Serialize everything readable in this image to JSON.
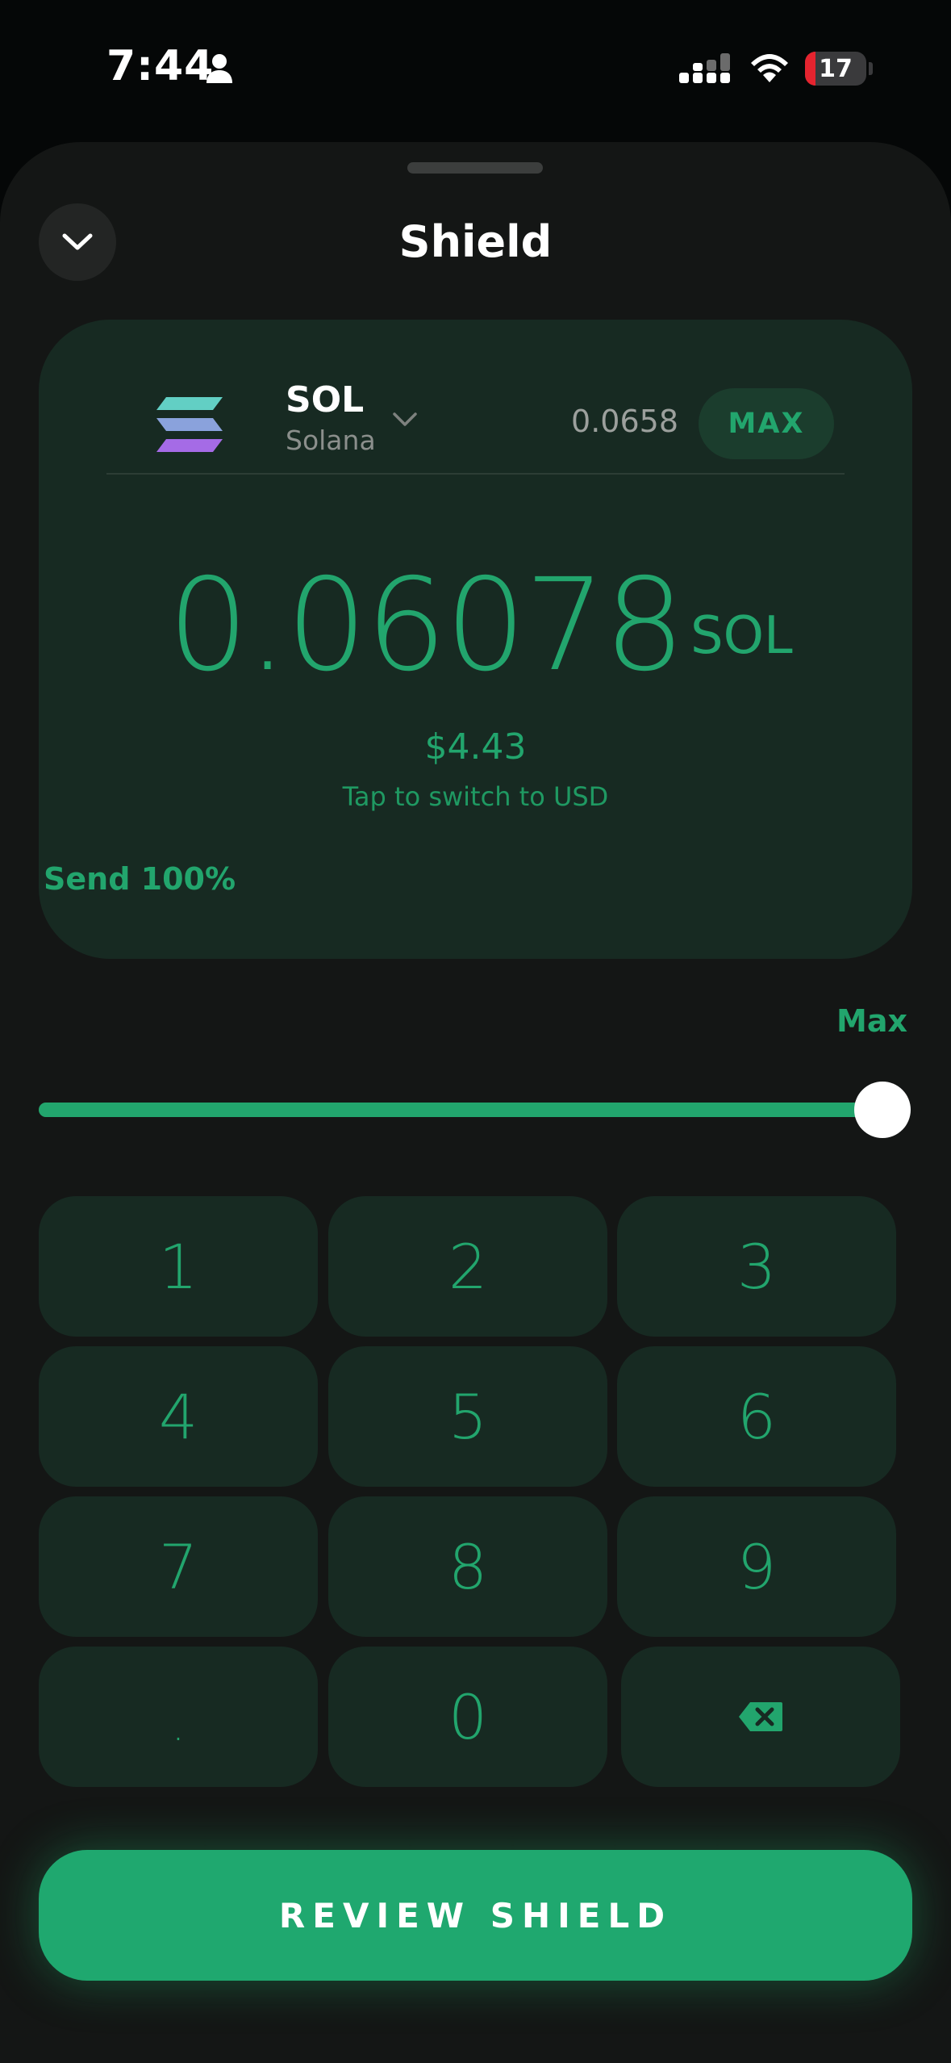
{
  "status": {
    "time": "7:44",
    "battery": "17",
    "battery_level": 0.17
  },
  "header": {
    "title": "Shield"
  },
  "token": {
    "symbol": "SOL",
    "name": "Solana",
    "balance": "0.0658",
    "max_label": "MAX"
  },
  "amount": {
    "value": "0.06078",
    "unit": "SOL",
    "usd": "$4.43",
    "switch_hint": "Tap to switch to USD"
  },
  "slider": {
    "label": "Send 100%",
    "max_label": "Max",
    "percent": 100
  },
  "keypad": {
    "keys": [
      "1",
      "2",
      "3",
      "4",
      "5",
      "6",
      "7",
      "8",
      "9",
      ".",
      "0"
    ]
  },
  "review": {
    "label": "REVIEW SHIELD"
  },
  "colors": {
    "accent": "#22a56d",
    "card": "#172a22",
    "sheet": "#141615"
  }
}
